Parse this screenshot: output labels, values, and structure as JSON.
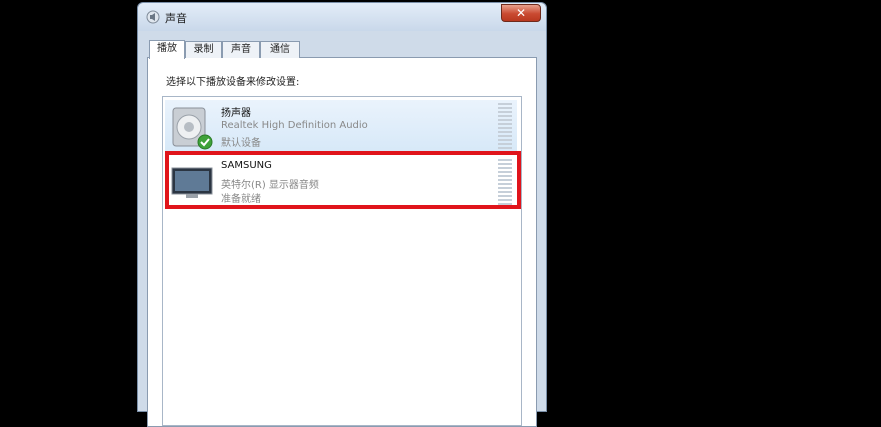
{
  "window": {
    "title": "声音",
    "close_label": "✕"
  },
  "tabs": [
    {
      "label": "播放",
      "active": true
    },
    {
      "label": "录制",
      "active": false
    },
    {
      "label": "声音",
      "active": false
    },
    {
      "label": "通信",
      "active": false
    }
  ],
  "instruction": "选择以下播放设备来修改设置:",
  "devices": [
    {
      "name": "扬声器",
      "description": "Realtek High Definition Audio",
      "status": "默认设备",
      "icon": "speaker-icon",
      "default": true
    },
    {
      "name": "SAMSUNG",
      "description": "英特尔(R) 显示器音频",
      "status": "准备就绪",
      "icon": "monitor-icon",
      "default": false
    }
  ],
  "colors": {
    "highlight": "#e0141b",
    "close": "#c94a31"
  }
}
